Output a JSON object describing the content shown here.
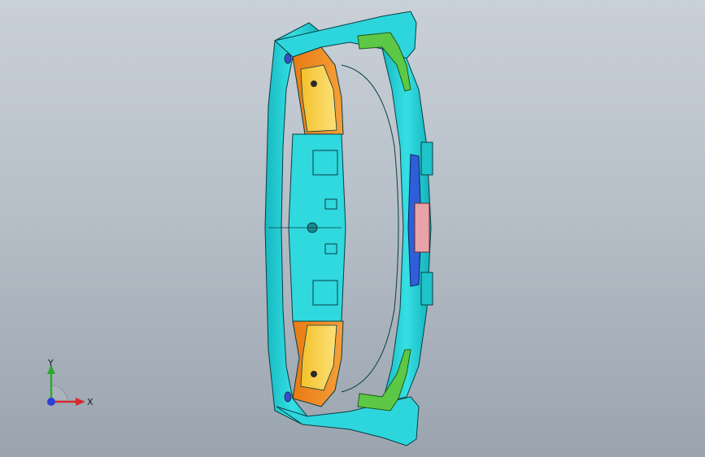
{
  "viewport": {
    "background_top": "#c9d0d8",
    "background_bottom": "#9aa4af"
  },
  "model": {
    "colors": {
      "cyan_body": "#25d4d9",
      "cyan_dark": "#0fa9b3",
      "orange_bracket": "#f08a1c",
      "yellow_face": "#f4c93a",
      "green_part": "#5cc846",
      "blue_plate": "#2f5fd8",
      "pink_part": "#e8a3a8",
      "edge_line": "#0b3c44"
    }
  },
  "triad": {
    "x_label": "X",
    "y_label": "Y",
    "x_color": "#d42a2a",
    "y_color": "#2fa82f",
    "z_color": "#2a3fd4"
  }
}
